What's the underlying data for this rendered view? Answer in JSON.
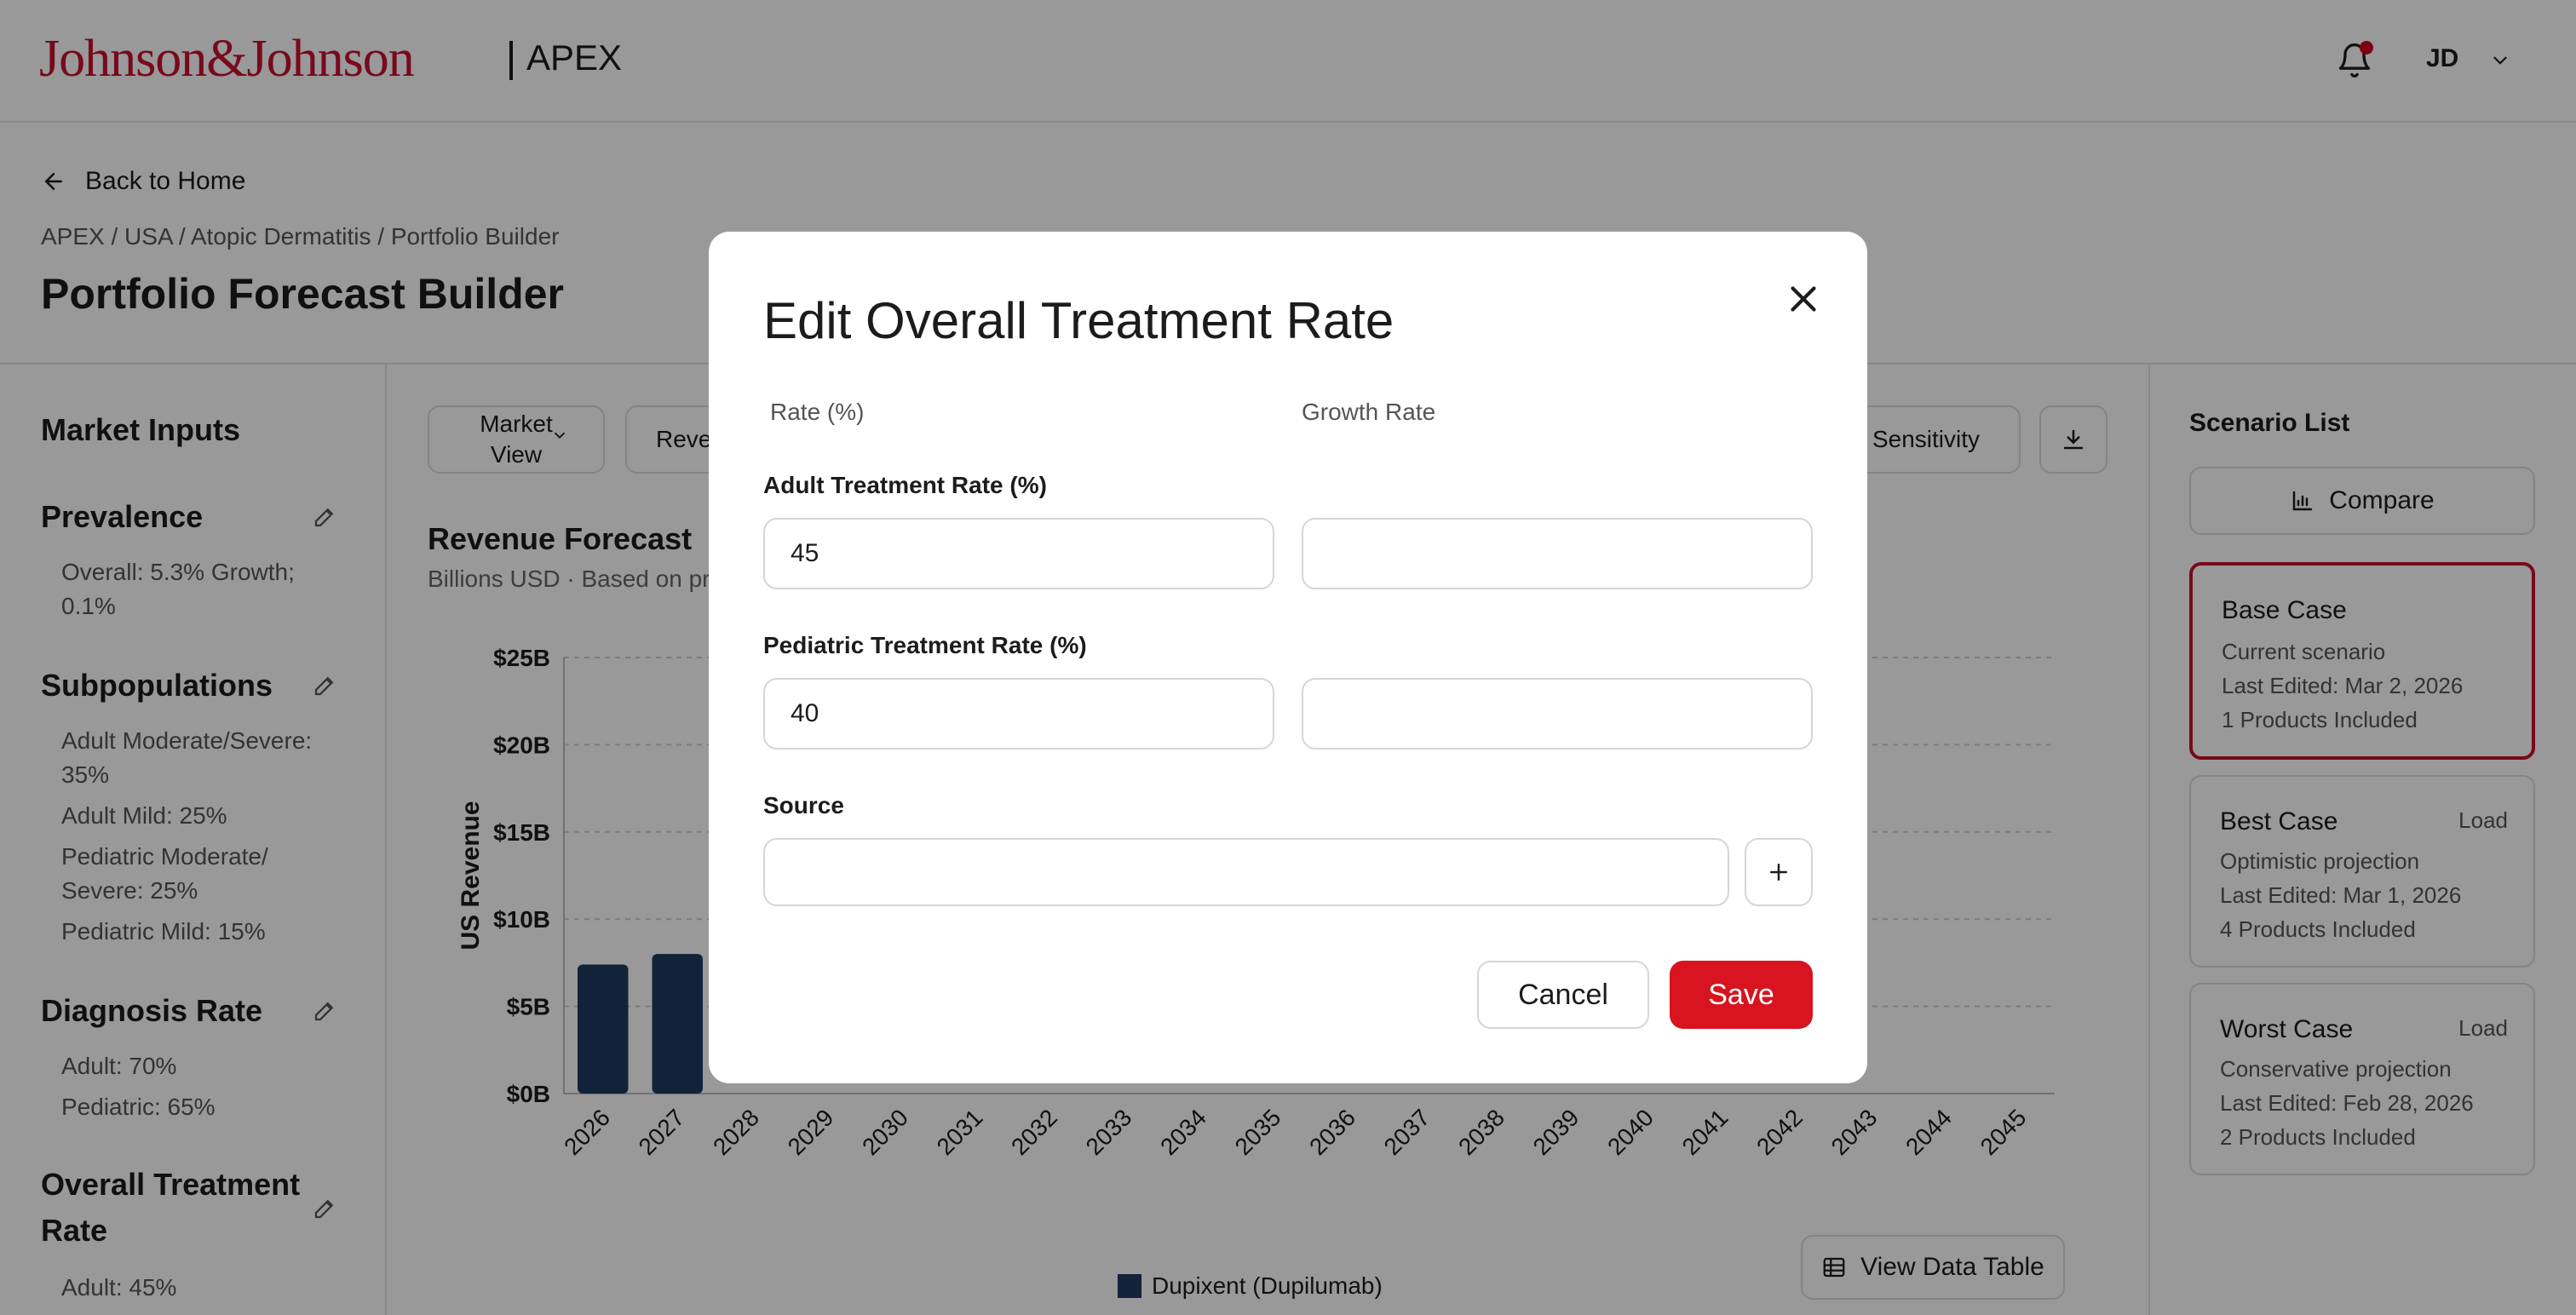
{
  "header": {
    "logo_text": "Johnson&Johnson",
    "app_name": "APEX",
    "user_initials": "JD",
    "brand_color": "#c8102e",
    "icons": {
      "bell": "bell-icon",
      "chevron": "chevron-down-icon"
    }
  },
  "nav": {
    "back_label": "Back to Home",
    "breadcrumb": "APEX / USA / Atopic Dermatitis / Portfolio Builder",
    "page_title": "Portfolio Forecast Builder"
  },
  "left_panel": {
    "title": "Market Inputs",
    "sections": [
      {
        "title": "Prevalence",
        "values": [
          "Overall: 5.3% Growth;",
          "0.1%"
        ]
      },
      {
        "title": "Subpopulations",
        "values": [
          "Adult Moderate/Severe:",
          "35%",
          "Adult Mild: 25%",
          "Pediatric Moderate/",
          "Severe: 25%",
          "Pediatric Mild: 15%"
        ]
      },
      {
        "title": "Diagnosis Rate",
        "values": [
          "Adult: 70%",
          "Pediatric: 65%"
        ]
      },
      {
        "title_line1": "Overall Treatment",
        "title_line2": "Rate",
        "values": [
          "Adult: 45%"
        ]
      }
    ]
  },
  "toolbar": {
    "market_view_line1": "Market",
    "market_view_line2": "View",
    "revenue_label": "Reve",
    "sensitivity_label": "Sensitivity",
    "icons": {
      "download": "download-icon"
    }
  },
  "chart": {
    "title": "Revenue Forecast",
    "subtitle": "Billions USD · Based on pr",
    "legend_label": "Dupixent (Dupilumab)",
    "view_table_label": "View Data Table"
  },
  "chart_data": {
    "type": "bar",
    "title": "Revenue Forecast",
    "subtitle": "Billions USD · Based on pr",
    "ylabel": "US Revenue",
    "xlabel": "",
    "categories": [
      "2026",
      "2027",
      "2028",
      "2029",
      "2030",
      "2031",
      "2032",
      "2033",
      "2034",
      "2035",
      "2036",
      "2037",
      "2038",
      "2039",
      "2040",
      "2041",
      "2042",
      "2043",
      "2044",
      "2045"
    ],
    "series": [
      {
        "name": "Dupixent (Dupilumab)",
        "color": "#1f3a5f",
        "values": [
          7.4,
          8.0,
          null,
          null,
          null,
          null,
          null,
          null,
          null,
          null,
          null,
          null,
          null,
          null,
          null,
          null,
          null,
          null,
          null,
          null
        ]
      }
    ],
    "ylim": [
      0,
      25
    ],
    "yticks": [
      "$0B",
      "$5B",
      "$10B",
      "$15B",
      "$20B",
      "$25B"
    ],
    "grid": true,
    "legend_position": "bottom"
  },
  "right_panel": {
    "title": "Scenario List",
    "compare_label": "Compare",
    "scenarios": [
      {
        "name": "Base Case",
        "desc": "Current scenario",
        "edited": "Last Edited: Mar 2, 2026",
        "products": "1 Products Included",
        "action": ""
      },
      {
        "name": "Best Case",
        "desc": "Optimistic projection",
        "edited": "Last Edited: Mar 1, 2026",
        "products": "4 Products Included",
        "action": "Load"
      },
      {
        "name": "Worst Case",
        "desc": "Conservative projection",
        "edited": "Last Edited: Feb 28, 2026",
        "products": "2 Products Included",
        "action": "Load"
      }
    ]
  },
  "modal": {
    "title": "Edit Overall Treatment Rate",
    "col_rate": "Rate (%)",
    "col_growth": "Growth Rate",
    "adult_label": "Adult Treatment Rate (%)",
    "adult_value": "45",
    "adult_growth": "",
    "pediatric_label": "Pediatric Treatment Rate (%)",
    "pediatric_value": "40",
    "pediatric_growth": "",
    "source_label": "Source",
    "source_value": "",
    "cancel_label": "Cancel",
    "save_label": "Save",
    "save_color": "#d7141f"
  }
}
